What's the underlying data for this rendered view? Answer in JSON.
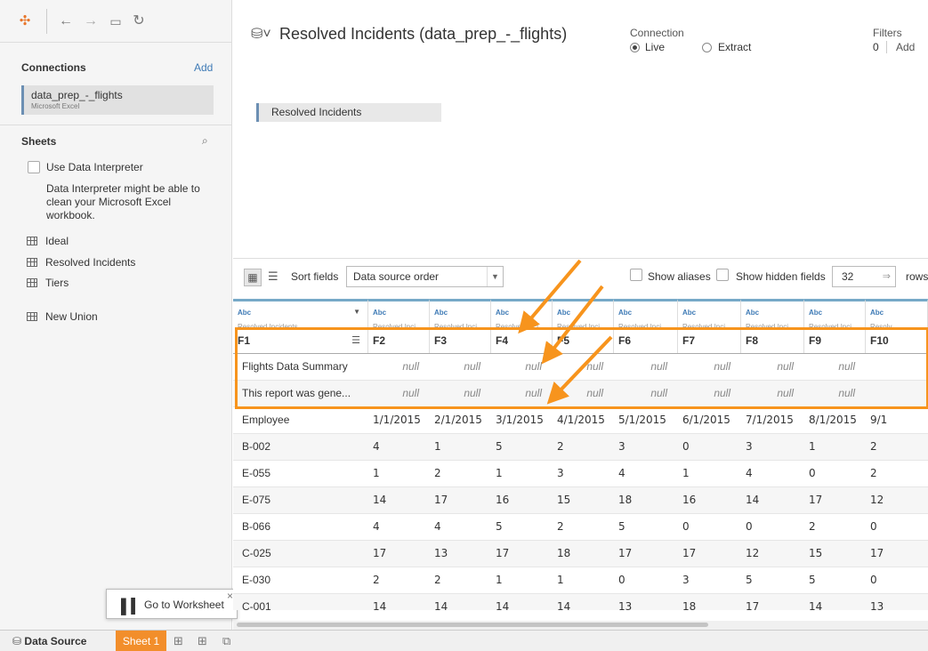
{
  "toolbar": {
    "icons": [
      "tableau-logo-icon",
      "back-icon",
      "forward-icon",
      "save-icon",
      "refresh-icon"
    ]
  },
  "connections": {
    "title": "Connections",
    "add_label": "Add",
    "item": {
      "name": "data_prep_-_flights",
      "type": "Microsoft Excel"
    }
  },
  "sheets": {
    "title": "Sheets",
    "use_interpreter_label": "Use Data Interpreter",
    "interpreter_note": "Data Interpreter might be able to clean your Microsoft Excel workbook.",
    "items": [
      {
        "label": "Ideal"
      },
      {
        "label": "Resolved Incidents"
      },
      {
        "label": "Tiers"
      }
    ],
    "new_union_label": "New Union"
  },
  "tooltip": {
    "label": "Go to Worksheet",
    "close": "×"
  },
  "header": {
    "title": "Resolved Incidents (data_prep_-_flights)",
    "connection_label": "Connection",
    "live_label": "Live",
    "extract_label": "Extract",
    "filters_label": "Filters",
    "filters_count": "0",
    "filters_add": "Add"
  },
  "canvas": {
    "table_pill": "Resolved Incidents"
  },
  "grid_toolbar": {
    "sort_label": "Sort fields",
    "sort_value": "Data source order",
    "show_aliases": "Show aliases",
    "show_hidden": "Show hidden fields",
    "rows_value": "32",
    "rows_label": "rows"
  },
  "grid": {
    "columns": [
      {
        "type": "Abc",
        "source": "Resolved Incidents",
        "name": "F1"
      },
      {
        "type": "Abc",
        "source": "Resolved Inci...",
        "name": "F2"
      },
      {
        "type": "Abc",
        "source": "Resolved Inci...",
        "name": "F3"
      },
      {
        "type": "Abc",
        "source": "Resolved Inci...",
        "name": "F4"
      },
      {
        "type": "Abc",
        "source": "Resolved Inci...",
        "name": "F5"
      },
      {
        "type": "Abc",
        "source": "Resolved Inci...",
        "name": "F6"
      },
      {
        "type": "Abc",
        "source": "Resolved Inci...",
        "name": "F7"
      },
      {
        "type": "Abc",
        "source": "Resolved Inci...",
        "name": "F8"
      },
      {
        "type": "Abc",
        "source": "Resolved Inci...",
        "name": "F9"
      },
      {
        "type": "Abc",
        "source": "Resolv",
        "name": "F10"
      }
    ],
    "rows": [
      [
        "Flights Data Summary",
        "null",
        "null",
        "null",
        "null",
        "null",
        "null",
        "null",
        "null",
        ""
      ],
      [
        "This report was gene...",
        "null",
        "null",
        "null",
        "null",
        "null",
        "null",
        "null",
        "null",
        ""
      ],
      [
        "Employee",
        "1/1/2015",
        "2/1/2015",
        "3/1/2015",
        "4/1/2015",
        "5/1/2015",
        "6/1/2015",
        "7/1/2015",
        "8/1/2015",
        "9/1"
      ],
      [
        "B-002",
        "4",
        "1",
        "5",
        "2",
        "3",
        "0",
        "3",
        "1",
        "2"
      ],
      [
        "E-055",
        "1",
        "2",
        "1",
        "3",
        "4",
        "1",
        "4",
        "0",
        "2"
      ],
      [
        "E-075",
        "14",
        "17",
        "16",
        "15",
        "18",
        "16",
        "14",
        "17",
        "12"
      ],
      [
        "B-066",
        "4",
        "4",
        "5",
        "2",
        "5",
        "0",
        "0",
        "2",
        "0"
      ],
      [
        "C-025",
        "17",
        "13",
        "17",
        "18",
        "17",
        "17",
        "12",
        "15",
        "17"
      ],
      [
        "E-030",
        "2",
        "2",
        "1",
        "1",
        "0",
        "3",
        "5",
        "5",
        "0"
      ],
      [
        "C-001",
        "14",
        "14",
        "14",
        "14",
        "13",
        "18",
        "17",
        "14",
        "13"
      ]
    ]
  },
  "bottom_tabs": {
    "data_source": "Data Source",
    "sheet1": "Sheet 1",
    "icons": [
      "new-worksheet-icon",
      "new-dashboard-icon",
      "new-story-icon"
    ]
  },
  "colors": {
    "highlight": "#f7941d",
    "sheet_tab": "#f28e2b",
    "accent": "#3f7bb6"
  }
}
